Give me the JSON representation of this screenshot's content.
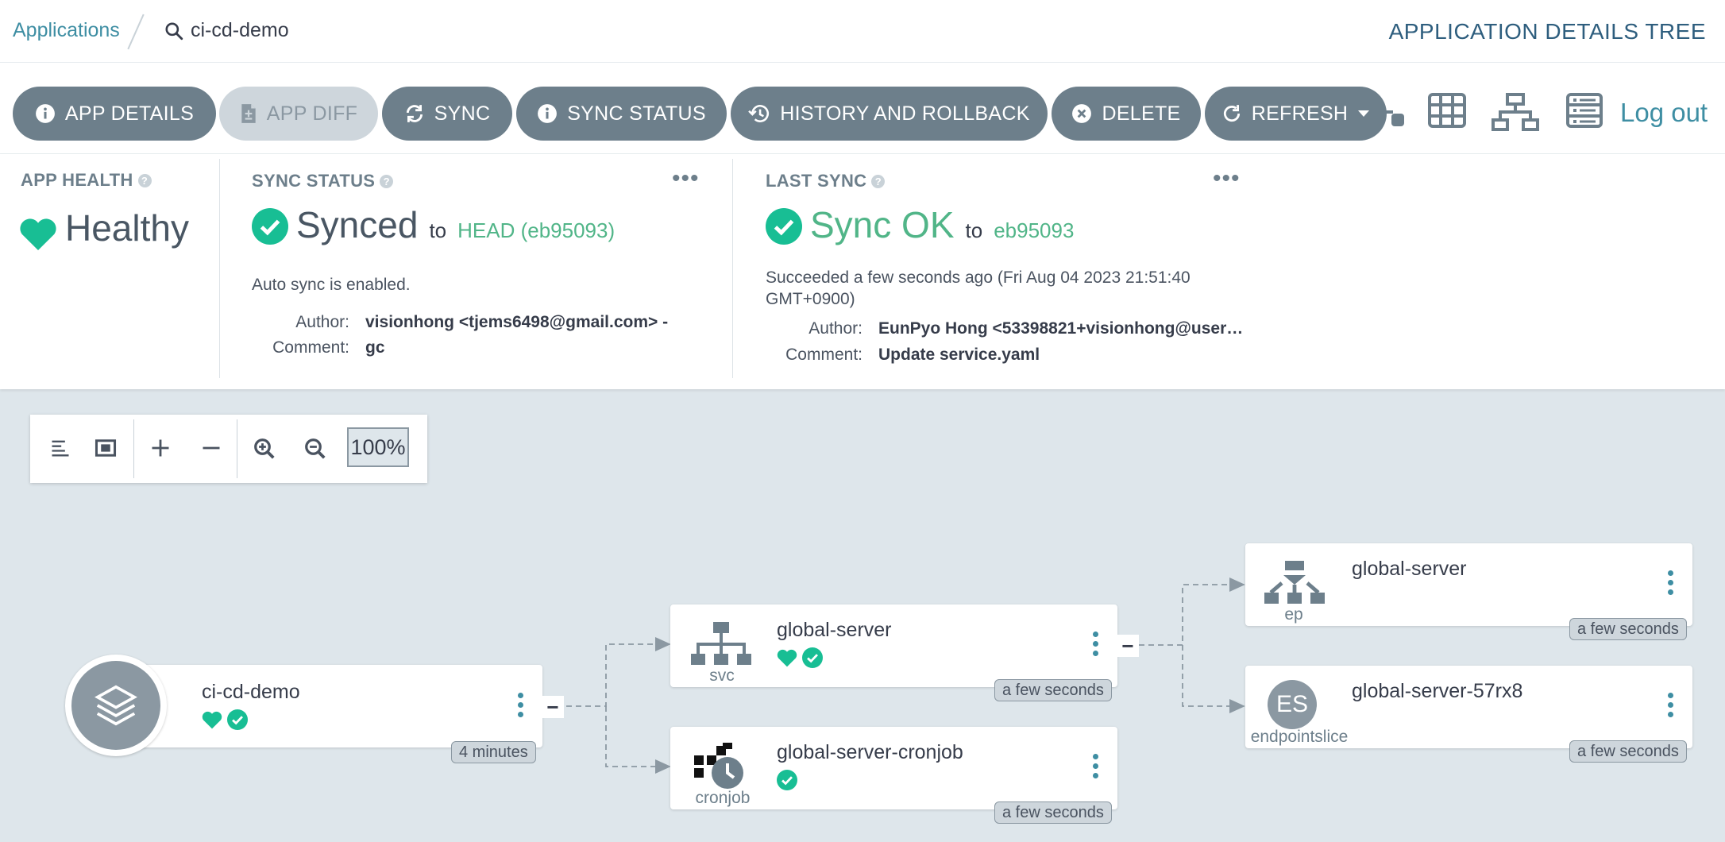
{
  "breadcrumb": {
    "root": "Applications",
    "current": "ci-cd-demo"
  },
  "page_title": "APPLICATION DETAILS TREE",
  "toolbar": {
    "buttons": [
      {
        "label": "APP DETAILS",
        "icon": "info-icon"
      },
      {
        "label": "APP DIFF",
        "icon": "file-diff-icon",
        "disabled": true
      },
      {
        "label": "SYNC",
        "icon": "sync-icon"
      },
      {
        "label": "SYNC STATUS",
        "icon": "info-icon"
      },
      {
        "label": "HISTORY AND ROLLBACK",
        "icon": "history-icon"
      },
      {
        "label": "DELETE",
        "icon": "close-circle-icon"
      },
      {
        "label": "REFRESH",
        "icon": "refresh-icon"
      }
    ],
    "views": [
      "network-view-icon",
      "pods-view-icon",
      "tree-view-icon",
      "list-view-icon"
    ],
    "logout": "Log out"
  },
  "status": {
    "health": {
      "title": "APP HEALTH",
      "value": "Healthy"
    },
    "sync": {
      "title": "SYNC STATUS",
      "value": "Synced",
      "to": "to",
      "revision": "HEAD (eb95093)",
      "auto": "Auto sync is enabled.",
      "author_label": "Author:",
      "author": "visionhong <tjems6498@gmail.com> -",
      "comment_label": "Comment:",
      "comment": "gc"
    },
    "last_sync": {
      "title": "LAST SYNC",
      "value": "Sync OK",
      "to": "to",
      "revision": "eb95093",
      "succeeded": "Succeeded a few seconds ago (Fri Aug 04 2023 21:51:40 GMT+0900)",
      "author_label": "Author:",
      "author": "EunPyo Hong <53398821+visionhong@user…",
      "comment_label": "Comment:",
      "comment": "Update service.yaml"
    }
  },
  "zoom": {
    "value": "100%"
  },
  "tree": {
    "app": {
      "name": "ci-cd-demo",
      "age": "4 minutes"
    },
    "svc": {
      "name": "global-server",
      "kind": "svc",
      "age": "a few seconds"
    },
    "cronjob": {
      "name": "global-server-cronjob",
      "kind": "cronjob",
      "age": "a few seconds"
    },
    "ep": {
      "name": "global-server",
      "kind": "ep",
      "age": "a few seconds"
    },
    "es": {
      "name": "global-server-57rx8",
      "kind": "endpointslice",
      "abbr": "ES",
      "age": "a few seconds"
    }
  },
  "colors": {
    "healthy": "#18be94",
    "synced": "#51b588",
    "accent": "#3e8ea3",
    "button": "#6d7f8b"
  }
}
